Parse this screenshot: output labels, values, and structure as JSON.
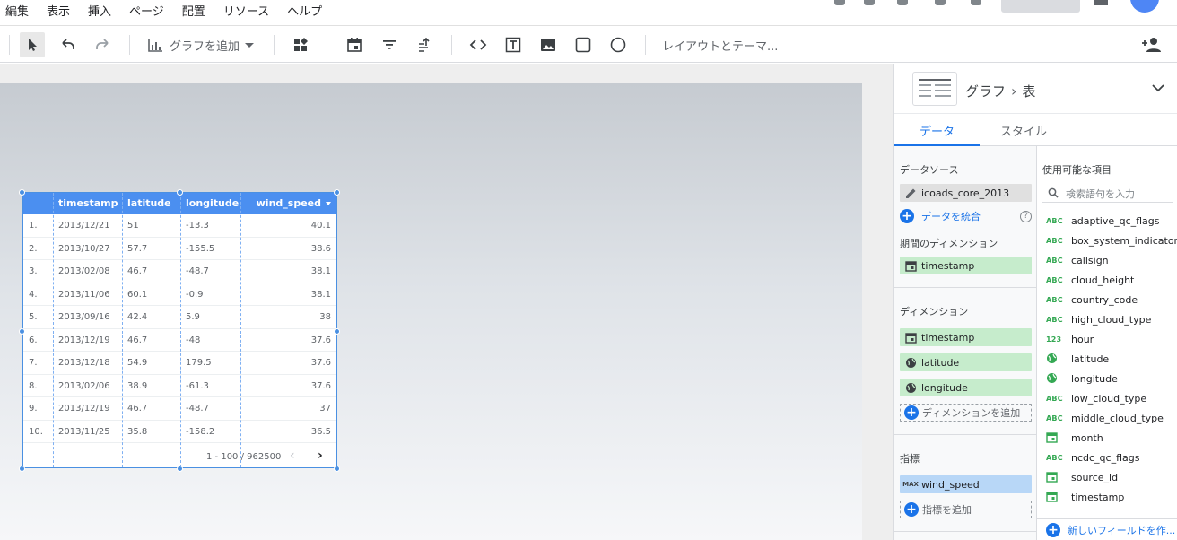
{
  "menu": [
    "編集",
    "表示",
    "挿入",
    "ページ",
    "配置",
    "リソース",
    "ヘルプ"
  ],
  "toolbar": {
    "add_chart_label": "グラフを追加",
    "layout_theme_label": "レイアウトとテーマ..."
  },
  "table": {
    "headers": [
      "",
      "timestamp",
      "latitude",
      "longitude",
      "wind_speed"
    ],
    "rows": [
      [
        "1.",
        "2013/12/21",
        "51",
        "-13.3",
        "40.1"
      ],
      [
        "2.",
        "2013/10/27",
        "57.7",
        "-155.5",
        "38.6"
      ],
      [
        "3.",
        "2013/02/08",
        "46.7",
        "-48.7",
        "38.1"
      ],
      [
        "4.",
        "2013/11/06",
        "60.1",
        "-0.9",
        "38.1"
      ],
      [
        "5.",
        "2013/09/16",
        "42.4",
        "5.9",
        "38"
      ],
      [
        "6.",
        "2013/12/19",
        "46.7",
        "-48",
        "37.6"
      ],
      [
        "7.",
        "2013/12/18",
        "54.9",
        "179.5",
        "37.6"
      ],
      [
        "8.",
        "2013/02/06",
        "38.9",
        "-61.3",
        "37.6"
      ],
      [
        "9.",
        "2013/12/19",
        "46.7",
        "-48.7",
        "37"
      ],
      [
        "10.",
        "2013/11/25",
        "35.8",
        "-158.2",
        "36.5"
      ]
    ],
    "pagination": "1 - 100 / 962500"
  },
  "panel": {
    "breadcrumb_root": "グラフ",
    "breadcrumb_current": "表",
    "tabs": [
      "データ",
      "スタイル"
    ],
    "data_source_label": "データソース",
    "data_source": "icoads_core_2013",
    "blend_data": "データを統合",
    "date_dim_label": "期間のディメンション",
    "date_dim": "timestamp",
    "dimension_label": "ディメンション",
    "dimensions": [
      "timestamp",
      "latitude",
      "longitude"
    ],
    "add_dimension": "ディメンションを追加",
    "metric_label": "指標",
    "metric_agg": "MAX",
    "metric": "wind_speed",
    "add_metric": "指標を追加"
  },
  "available": {
    "title": "使用可能な項目",
    "search_placeholder": "検索語句を入力",
    "fields": [
      {
        "type": "text",
        "icon_label": "ABC",
        "name": "adaptive_qc_flags"
      },
      {
        "type": "text",
        "icon_label": "ABC",
        "name": "box_system_indicator"
      },
      {
        "type": "text",
        "icon_label": "ABC",
        "name": "callsign"
      },
      {
        "type": "text",
        "icon_label": "ABC",
        "name": "cloud_height"
      },
      {
        "type": "text",
        "icon_label": "ABC",
        "name": "country_code"
      },
      {
        "type": "text",
        "icon_label": "ABC",
        "name": "high_cloud_type"
      },
      {
        "type": "number",
        "icon_label": "123",
        "name": "hour"
      },
      {
        "type": "geo",
        "icon_label": "",
        "name": "latitude"
      },
      {
        "type": "geo",
        "icon_label": "",
        "name": "longitude"
      },
      {
        "type": "text",
        "icon_label": "ABC",
        "name": "low_cloud_type"
      },
      {
        "type": "text",
        "icon_label": "ABC",
        "name": "middle_cloud_type"
      },
      {
        "type": "date",
        "icon_label": "",
        "name": "month"
      },
      {
        "type": "text",
        "icon_label": "ABC",
        "name": "ncdc_qc_flags"
      },
      {
        "type": "date",
        "icon_label": "",
        "name": "source_id"
      },
      {
        "type": "date",
        "icon_label": "",
        "name": "timestamp"
      }
    ],
    "new_field": "新しいフィールドを作..."
  },
  "colors": {
    "accent": "#1a73e8",
    "table_header": "#4b8ff0",
    "dimension_chip": "#c6eccc",
    "metric_chip": "#b8d7f7"
  }
}
